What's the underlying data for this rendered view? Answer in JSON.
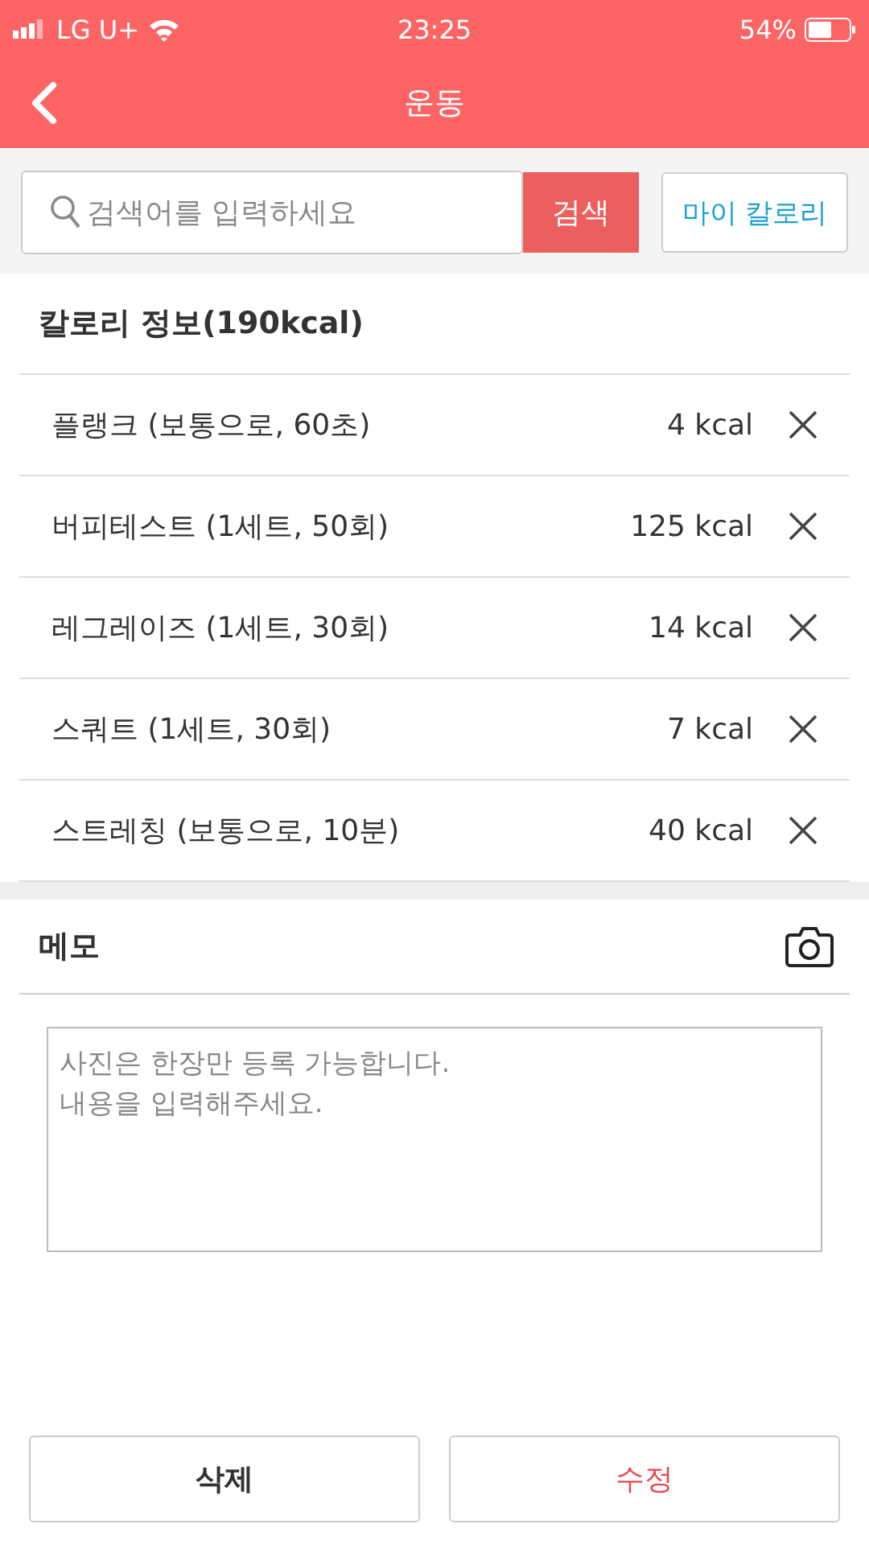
{
  "status_bar": {
    "carrier": "LG U+",
    "time": "23:25",
    "battery": "54%"
  },
  "header": {
    "title": "운동"
  },
  "search": {
    "placeholder": "검색어를 입력하세요",
    "button": "검색",
    "my_button": "마이 칼로리"
  },
  "calorie_section": {
    "title": "칼로리 정보(190kcal)",
    "items": [
      {
        "name": "플랭크 (보통으로, 60초)",
        "kcal": "4 kcal"
      },
      {
        "name": "버피테스트 (1세트, 50회)",
        "kcal": "125 kcal"
      },
      {
        "name": "레그레이즈 (1세트, 30회)",
        "kcal": "14 kcal"
      },
      {
        "name": "스쿼트 (1세트, 30회)",
        "kcal": "7 kcal"
      },
      {
        "name": "스트레칭 (보통으로, 10분)",
        "kcal": "40 kcal"
      }
    ]
  },
  "memo": {
    "title": "메모",
    "placeholder": "사진은 한장만 등록 가능합니다.\n내용을 입력해주세요."
  },
  "buttons": [
    {
      "label": "삭제",
      "kind": "neutral"
    },
    {
      "label": "수정",
      "kind": "accent"
    }
  ]
}
